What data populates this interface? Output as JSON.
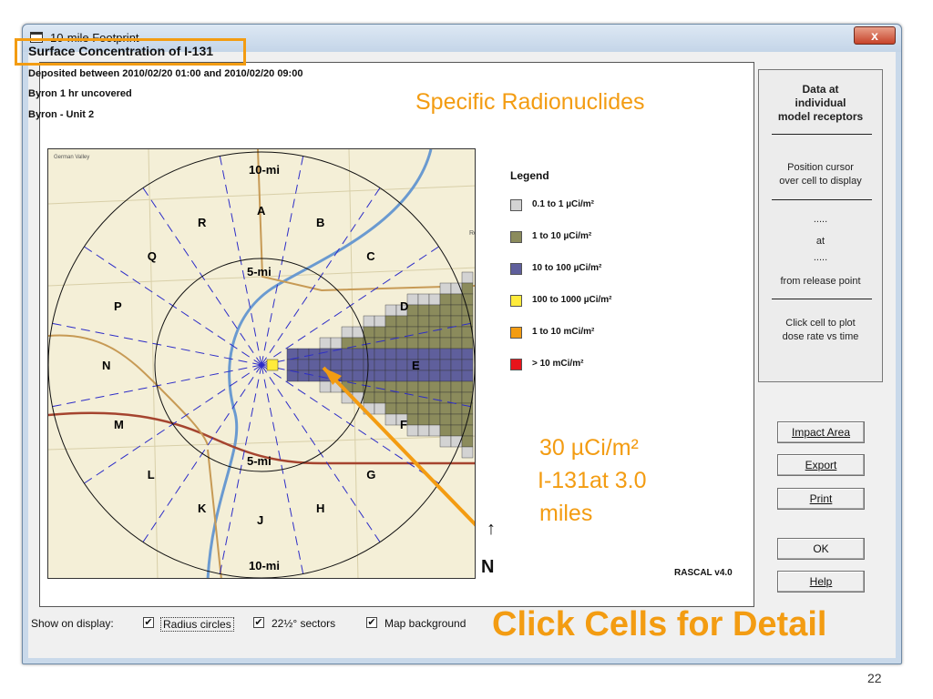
{
  "window": {
    "title": "10-mile Footprint",
    "close_label": "x"
  },
  "header": {
    "title": "Surface Concentration of I-131",
    "deposited": "Deposited between 2010/02/20 01:00 and 2010/02/20 09:00",
    "scenario": "Byron 1 hr uncovered",
    "unit": "Byron - Unit 2"
  },
  "annotations": {
    "specific": "Specific Radionuclides",
    "conc_line1": "30 µCi/m²",
    "conc_line2": " I-131at 3.0",
    "conc_line3": "miles",
    "click_cells": "Click Cells for Detail"
  },
  "map": {
    "town_label": "German Valley",
    "ring_labels": {
      "ten_top": "10-mi",
      "five_top": "5-mi",
      "five_bottom": "5-mi",
      "ten_bottom": "10-mi"
    },
    "sectors": [
      "A",
      "B",
      "C",
      "D",
      "E",
      "F",
      "G",
      "H",
      "J",
      "K",
      "L",
      "M",
      "N",
      "P",
      "Q",
      "R"
    ],
    "edge_label": "Re",
    "north": "N",
    "north_arrow": "↑",
    "version": "RASCAL v4.0"
  },
  "legend": {
    "title": "Legend",
    "items": [
      {
        "label": "0.1 to 1 µCi/m²",
        "color": "#d3d3d3"
      },
      {
        "label": "1 to 10 µCi/m²",
        "color": "#8b8b5c"
      },
      {
        "label": "10 to 100 µCi/m²",
        "color": "#5f5f9c"
      },
      {
        "label": "100 to 1000 µCi/m²",
        "color": "#ffeb3b"
      },
      {
        "label": "1 to 10 mCi/m²",
        "color": "#f39c12"
      },
      {
        "label": "> 10 mCi/m²",
        "color": "#e8141b"
      }
    ]
  },
  "info_panel": {
    "title_1": "Data at",
    "title_2": "individual",
    "title_3": "model receptors",
    "instruction_1": "Position cursor",
    "instruction_2": "over cell to display",
    "value_placeholder": ".....",
    "at": "at",
    "distance_placeholder": ".....",
    "from_release": "from release point",
    "click_hint_1": "Click cell to plot",
    "click_hint_2": "dose rate vs time"
  },
  "buttons": {
    "impact_area": "Impact Area",
    "export": "Export",
    "print": "Print",
    "ok": "OK",
    "help": "Help"
  },
  "footer": {
    "show_label": "Show on display:",
    "options": [
      {
        "label": "Radius circles",
        "checked": true
      },
      {
        "label": "22½° sectors",
        "checked": true
      },
      {
        "label": "Map background",
        "checked": true
      }
    ]
  },
  "check_mark": "✔",
  "page_number": "22"
}
